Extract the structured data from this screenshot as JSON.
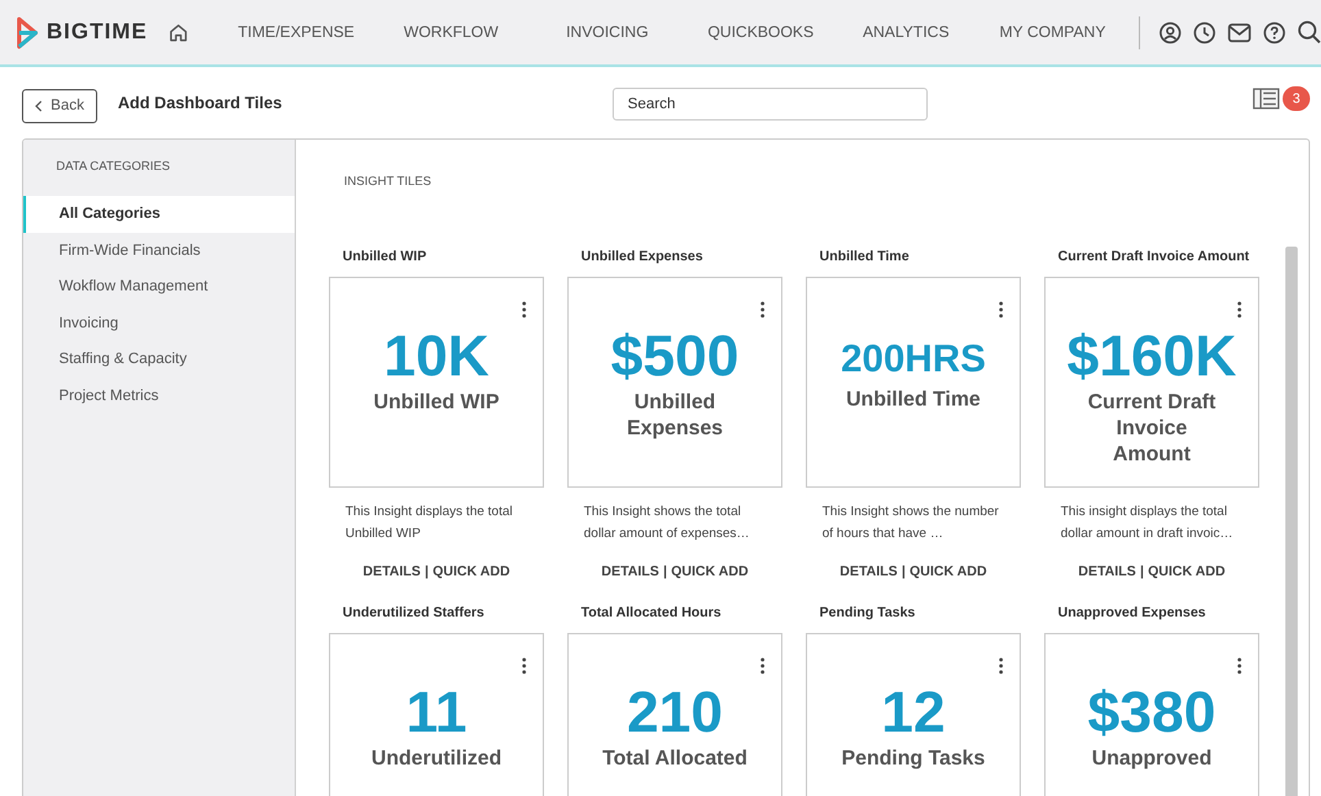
{
  "brand": "BIGTIME",
  "nav": [
    {
      "label": "TIME/EXPENSE"
    },
    {
      "label": "WORKFLOW"
    },
    {
      "label": "INVOICING"
    },
    {
      "label": "QUICKBOOKS"
    },
    {
      "label": "ANALYTICS"
    },
    {
      "label": "MY COMPANY"
    }
  ],
  "toolbar": {
    "back": "Back",
    "title": "Add Dashboard Tiles",
    "search": {
      "placeholder": "Search"
    },
    "badge": "3"
  },
  "sidebar": {
    "heading": "DATA CATEGORIES",
    "items": [
      {
        "label": "All Categories",
        "selected": true
      },
      {
        "label": "Firm-Wide Financials",
        "selected": false
      },
      {
        "label": "Wokflow Management",
        "selected": false
      },
      {
        "label": "Invoicing",
        "selected": false
      },
      {
        "label": "Staffing & Capacity",
        "selected": false
      },
      {
        "label": "Project Metrics",
        "selected": false
      }
    ]
  },
  "content": {
    "heading": "INSIGHT TILES",
    "tiles": [
      {
        "title": "Unbilled WIP",
        "value": "10K",
        "label": "Unbilled WIP",
        "description": "This Insight displays the total Unbilled WIP",
        "details": "DETAILS",
        "separator": "|",
        "quick_add": "QUICK ADD"
      },
      {
        "title": "Unbilled Expenses",
        "value": "$500",
        "label": "Unbilled Expenses",
        "description": "This Insight shows the total dollar amount of expenses…",
        "details": "DETAILS",
        "separator": "|",
        "quick_add": "QUICK ADD"
      },
      {
        "title": "Unbilled Time",
        "value": "200HRS",
        "label": "Unbilled Time",
        "description": "This Insight shows the number of hours that have …",
        "details": "DETAILS",
        "separator": "|",
        "quick_add": "QUICK ADD"
      },
      {
        "title": "Current Draft Invoice Amount",
        "value": "$160K",
        "label": "Current Draft Invoice Amount",
        "description": "This insight displays the total dollar amount in draft invoic…",
        "details": "DETAILS",
        "separator": "|",
        "quick_add": "QUICK ADD"
      },
      {
        "title": "Underutilized Staffers",
        "value": "11",
        "label": "Underutilized"
      },
      {
        "title": "Total Allocated Hours",
        "value": "210",
        "label": "Total Allocated"
      },
      {
        "title": "Pending Tasks",
        "value": "12",
        "label": "Pending Tasks"
      },
      {
        "title": "Unapproved Expenses",
        "value": "$380",
        "label": "Unapproved"
      }
    ]
  }
}
